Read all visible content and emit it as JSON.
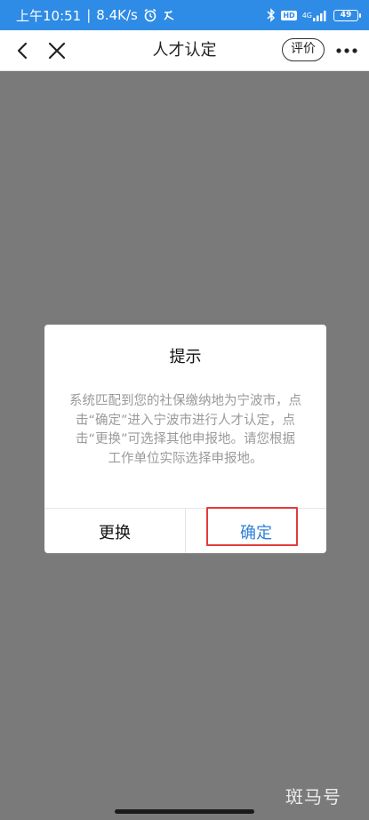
{
  "status_bar": {
    "time": "上午10:51",
    "speed": "8.4K/s",
    "battery": "49",
    "network": "4G",
    "hd": "HD",
    "icons": [
      "alarm-icon",
      "notification-icon",
      "bluetooth-icon",
      "hd-icon",
      "signal-icon",
      "battery-icon"
    ]
  },
  "nav": {
    "title": "人才认定",
    "rate_label": "评价",
    "icons": [
      "back-icon",
      "close-icon",
      "more-icon"
    ]
  },
  "dialog": {
    "title": "提示",
    "message": "系统匹配到您的社保缴纳地为宁波市，点击“确定”进入宁波市进行人才认定，点击“更换”可选择其他申报地。请您根据工作单位实际选择申报地。",
    "cancel_label": "更换",
    "confirm_label": "确定"
  },
  "colors": {
    "status_bar_bg": "#2e8be6",
    "overlay": "#7a7a7a",
    "confirm_text": "#2e7fd6",
    "highlight_border": "#e33b3b"
  },
  "watermark": "斑马号"
}
